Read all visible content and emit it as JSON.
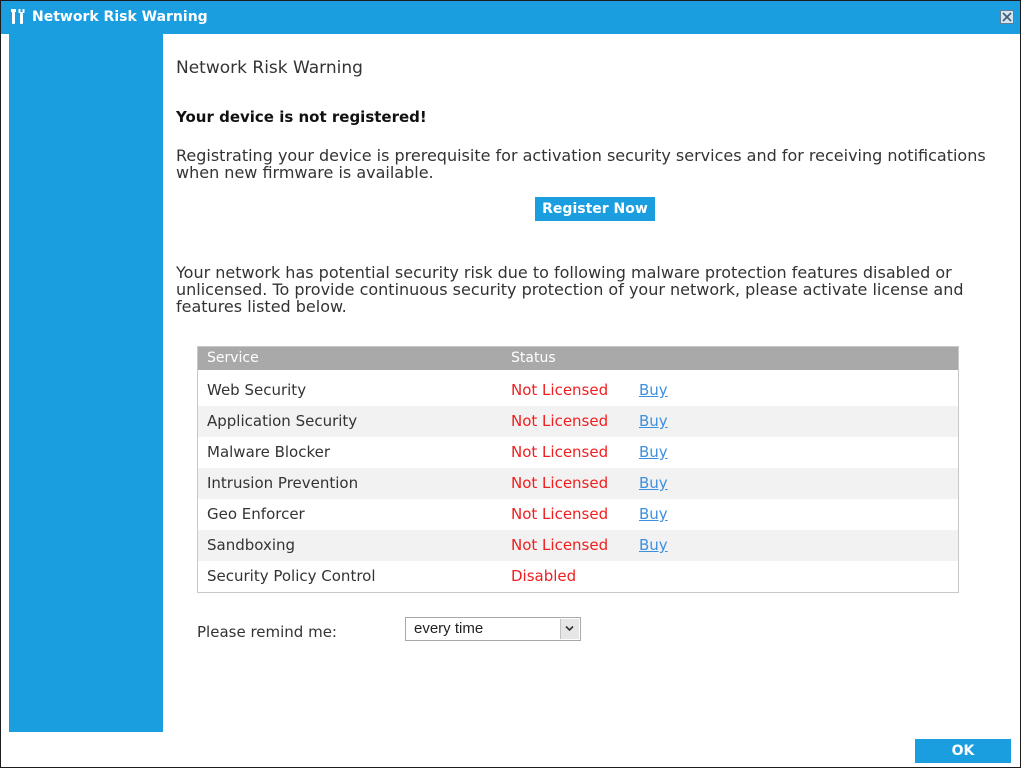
{
  "window": {
    "title": "Network Risk Warning"
  },
  "content": {
    "heading": "Network Risk Warning",
    "subheading": "Your device is not registered!",
    "register_text": "Registrating your device is prerequisite for activation security services and for receiving notifications when new firmware is available.",
    "register_button": "Register Now",
    "risk_text": "Your network has potential security risk due to following malware protection features disabled or unlicensed. To provide continuous security protection of your network, please activate license and features listed below."
  },
  "table": {
    "headers": [
      "Service",
      "Status"
    ],
    "rows": [
      {
        "service": "Web Security",
        "status": "Not Licensed",
        "action": "Buy"
      },
      {
        "service": "Application Security",
        "status": "Not Licensed",
        "action": "Buy"
      },
      {
        "service": "Malware Blocker",
        "status": "Not Licensed",
        "action": "Buy"
      },
      {
        "service": "Intrusion Prevention",
        "status": "Not Licensed",
        "action": "Buy"
      },
      {
        "service": "Geo Enforcer",
        "status": "Not Licensed",
        "action": "Buy"
      },
      {
        "service": "Sandboxing",
        "status": "Not Licensed",
        "action": "Buy"
      },
      {
        "service": "Security Policy Control",
        "status": "Disabled"
      }
    ]
  },
  "remind": {
    "label": "Please remind me:",
    "selected": "every time"
  },
  "footer": {
    "ok_label": "OK"
  },
  "icons": {
    "title": "wrench-screwdriver-icon",
    "close": "close-icon",
    "dropdown": "chevron-down-icon"
  },
  "colors": {
    "accent": "#1a9ee0",
    "status_alert": "#f01e1e",
    "link": "#3d8fe0",
    "table_header": "#a9a9a9"
  }
}
